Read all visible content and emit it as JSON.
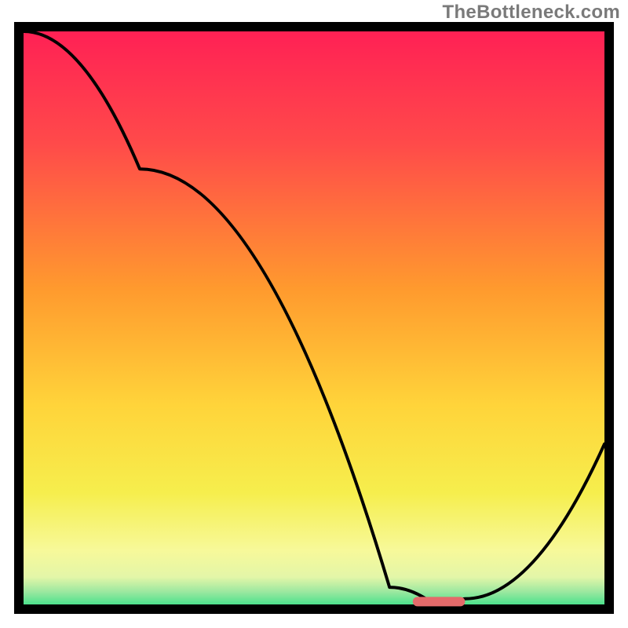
{
  "watermark": {
    "text": "TheBottleneck.com"
  },
  "chart_data": {
    "type": "line",
    "title": "",
    "xlabel": "",
    "ylabel": "",
    "xlim": [
      0,
      100
    ],
    "ylim": [
      0,
      100
    ],
    "grid": false,
    "legend": false,
    "series": [
      {
        "name": "bottleneck-curve",
        "x": [
          0,
          20,
          63,
          70,
          76,
          100
        ],
        "values": [
          100,
          76,
          3,
          0.5,
          1,
          28
        ]
      }
    ],
    "marker": {
      "name": "optimal-range",
      "shape": "pill",
      "color": "#e46a6a",
      "x_start": 67,
      "x_end": 76,
      "y": 0.5
    },
    "background_gradient": {
      "stops": [
        {
          "offset": 0.0,
          "color": "#ff1f55"
        },
        {
          "offset": 0.2,
          "color": "#ff4a4a"
        },
        {
          "offset": 0.45,
          "color": "#ff9a2e"
        },
        {
          "offset": 0.65,
          "color": "#ffd43a"
        },
        {
          "offset": 0.8,
          "color": "#f6ee4d"
        },
        {
          "offset": 0.9,
          "color": "#f7f99a"
        },
        {
          "offset": 0.945,
          "color": "#e3f6a8"
        },
        {
          "offset": 0.97,
          "color": "#9ce8a0"
        },
        {
          "offset": 1.0,
          "color": "#2fdf85"
        }
      ]
    }
  }
}
